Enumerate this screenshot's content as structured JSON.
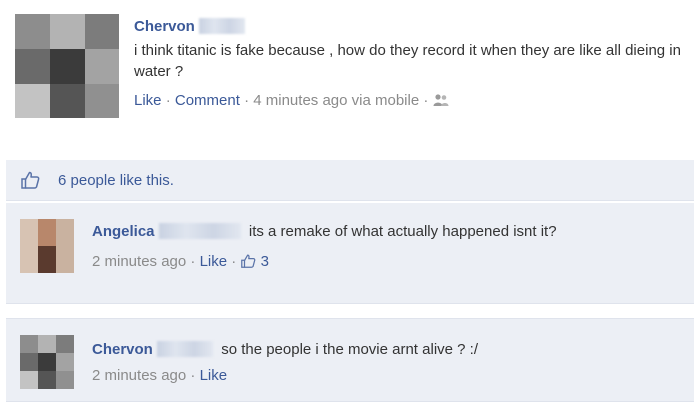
{
  "post": {
    "author": "Chervon",
    "text": "i think titanic is fake because , how do they record it when they are like all dieing in water ?",
    "like_label": "Like",
    "comment_label": "Comment",
    "timestamp": "4 minutes ago via mobile"
  },
  "likes": {
    "summary": "6 people like this."
  },
  "comments": [
    {
      "author": "Angelica",
      "text": "its a remake of what actually happened isnt it?",
      "timestamp": "2 minutes ago",
      "like_label": "Like",
      "like_count": "3"
    },
    {
      "author": "Chervon",
      "text": "so the people i the movie arnt alive ? :/",
      "timestamp": "2 minutes ago",
      "like_label": "Like"
    }
  ],
  "colors": {
    "link": "#3b5998",
    "panel_bg": "#eceff5",
    "muted_text": "#8a8a8a"
  },
  "icons": [
    "thumbs-up-icon",
    "audience-icon"
  ]
}
